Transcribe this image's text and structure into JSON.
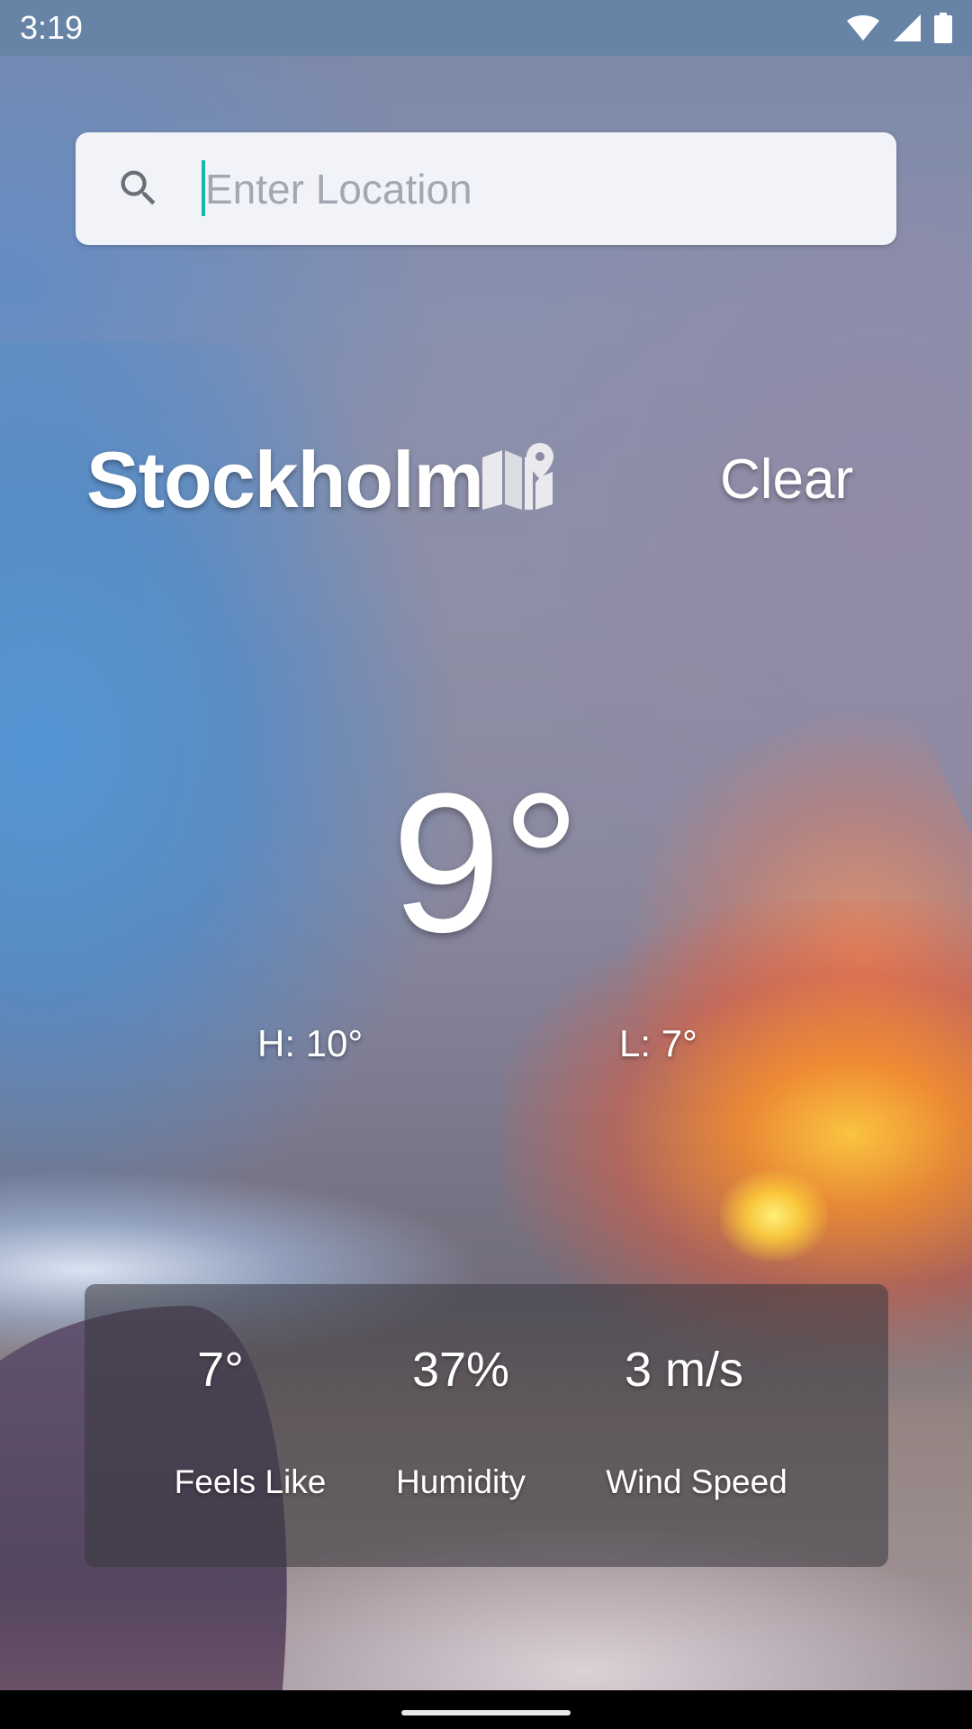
{
  "status_bar": {
    "time": "3:19",
    "icons": [
      "wifi-icon",
      "cellular-signal-icon",
      "battery-icon"
    ]
  },
  "search": {
    "placeholder": "Enter Location",
    "value": "",
    "icon": "search-icon"
  },
  "location": {
    "city": "Stockholm",
    "map_icon": "map-pin-icon",
    "condition": "Clear"
  },
  "weather": {
    "temperature": "9°",
    "high": "H: 10°",
    "low": "L: 7°"
  },
  "stats": [
    {
      "value": "7°",
      "label": "Feels Like"
    },
    {
      "value": "37%",
      "label": "Humidity"
    },
    {
      "value": "3 m/s",
      "label": "Wind Speed"
    }
  ],
  "colors": {
    "status_bar": "#6783a5",
    "search_background": "#f1f3f8",
    "caret": "#19b7a5",
    "text": "#ffffff"
  }
}
